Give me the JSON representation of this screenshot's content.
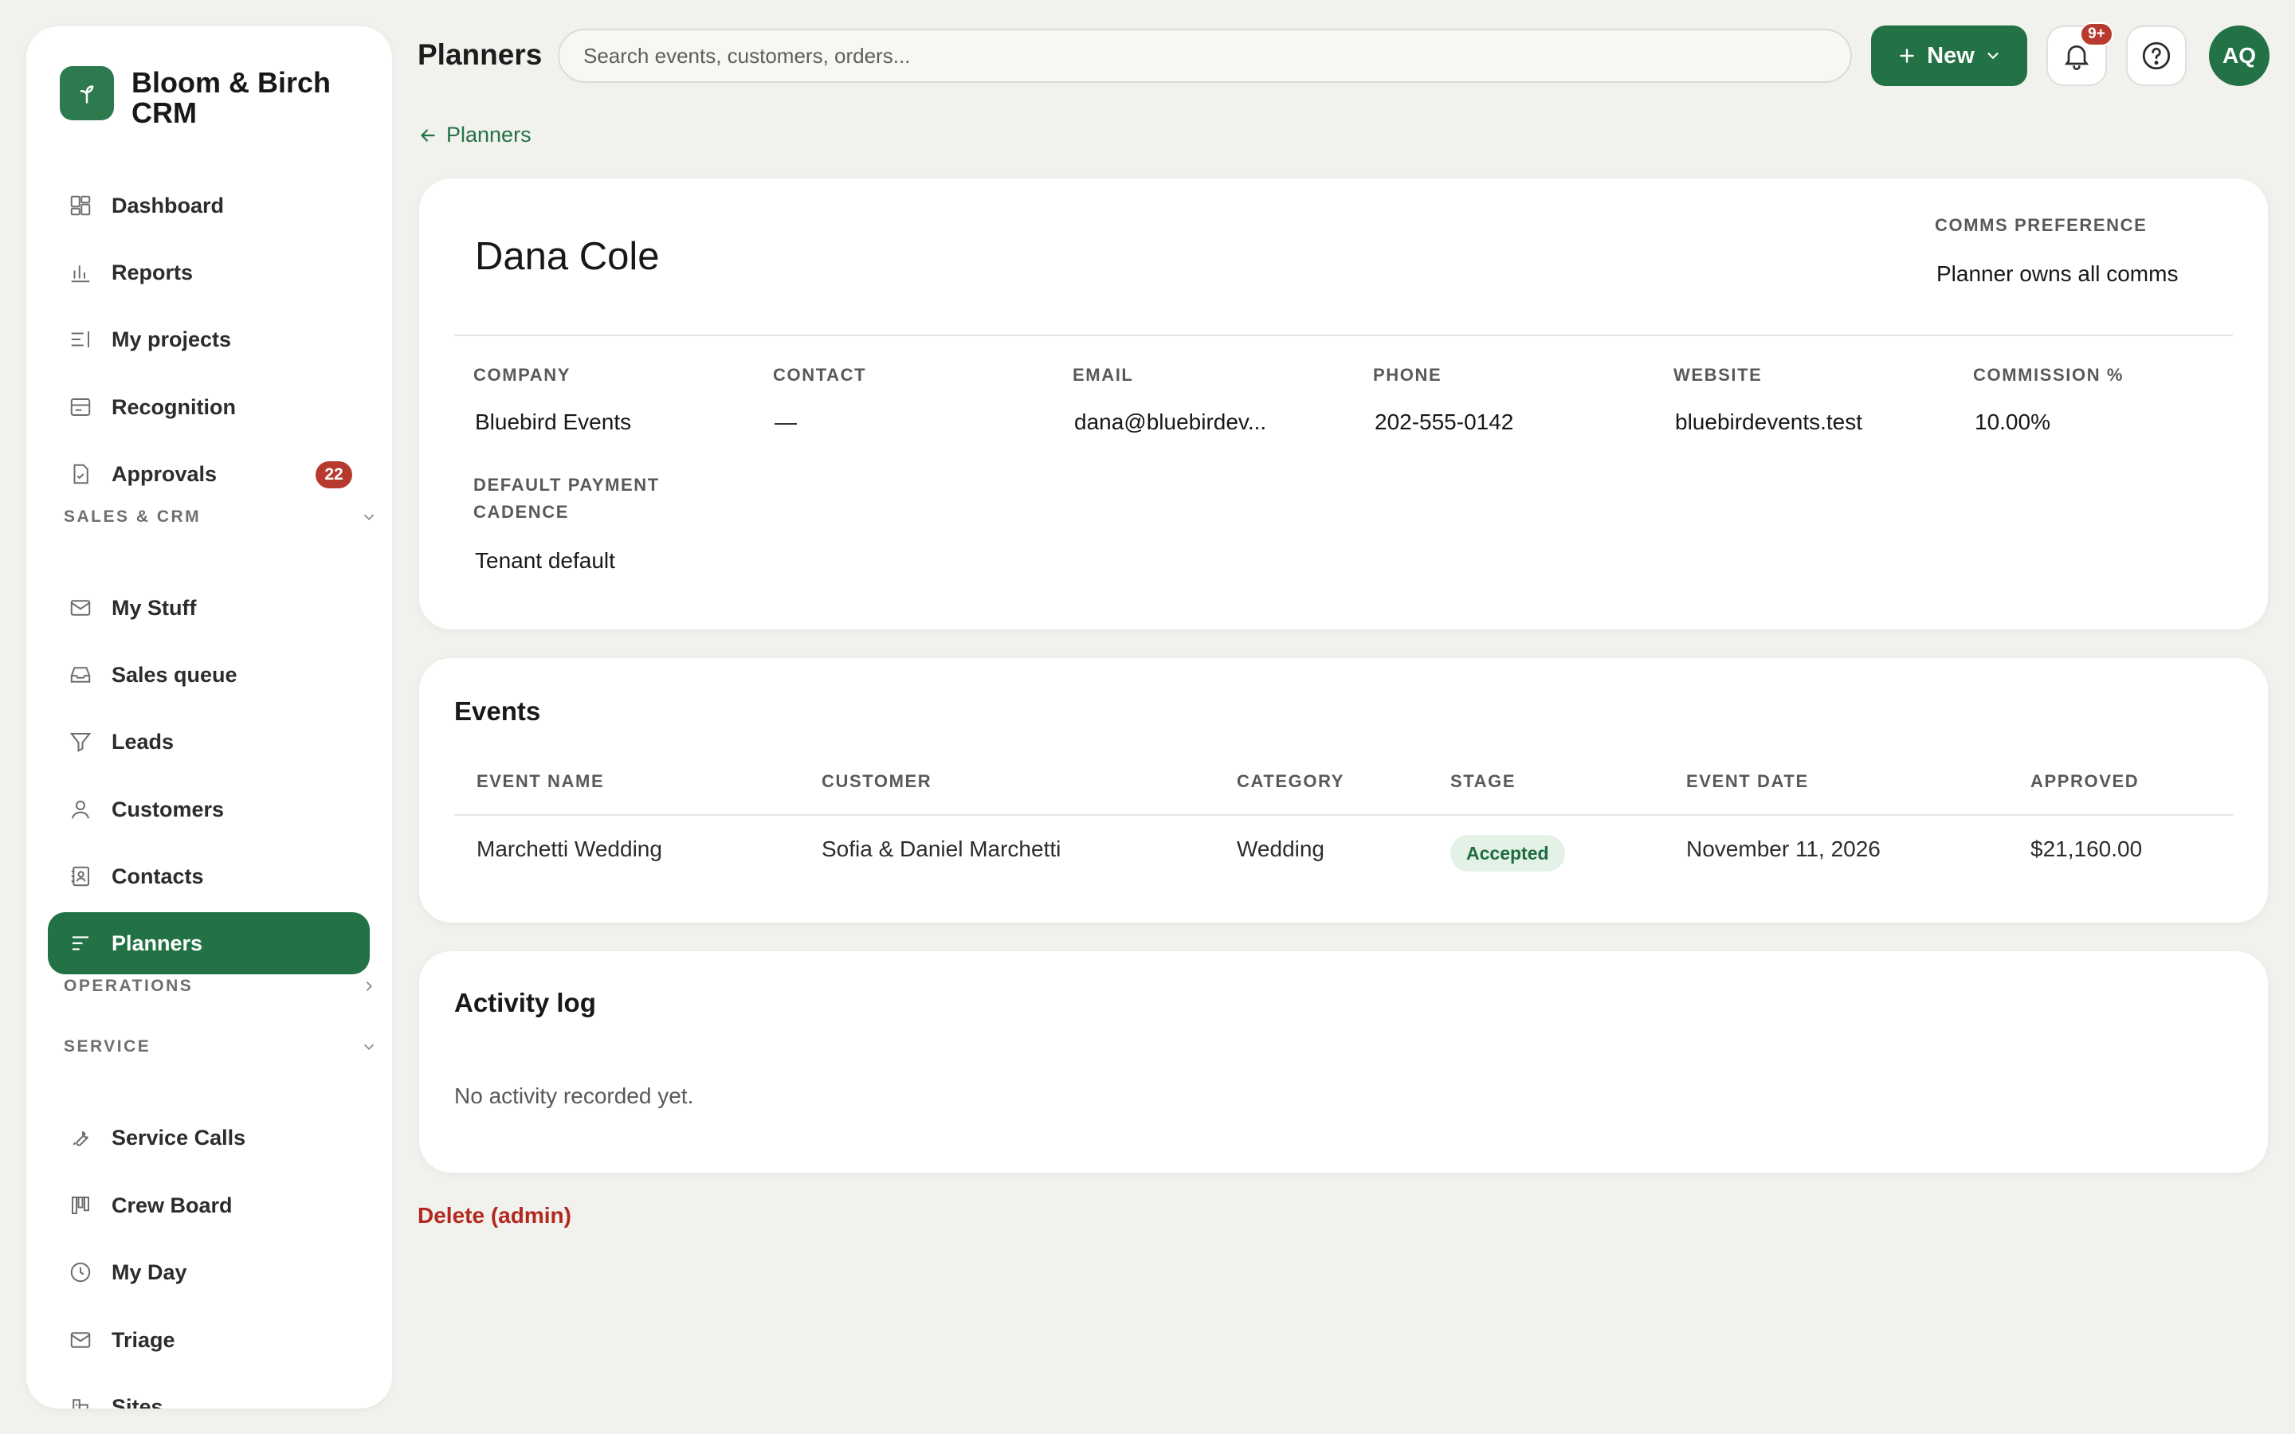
{
  "app": {
    "name": "Bloom & Birch CRM"
  },
  "sidebar": {
    "top_items": [
      {
        "label": "Dashboard",
        "icon": "dashboard-icon"
      },
      {
        "label": "Reports",
        "icon": "bar-chart-icon"
      },
      {
        "label": "My projects",
        "icon": "list-icon"
      },
      {
        "label": "Recognition",
        "icon": "card-icon"
      },
      {
        "label": "Approvals",
        "icon": "document-check-icon",
        "badge": "22"
      }
    ],
    "sections": [
      {
        "label": "SALES & CRM",
        "state": "expanded"
      },
      {
        "label": "OPERATIONS",
        "state": "collapsed"
      },
      {
        "label": "SERVICE",
        "state": "expanded"
      }
    ],
    "sales_items": [
      {
        "label": "My Stuff",
        "icon": "mail-icon"
      },
      {
        "label": "Sales queue",
        "icon": "inbox-icon"
      },
      {
        "label": "Leads",
        "icon": "filter-icon"
      },
      {
        "label": "Customers",
        "icon": "user-icon"
      },
      {
        "label": "Contacts",
        "icon": "contact-book-icon"
      },
      {
        "label": "Planners",
        "icon": "planner-icon",
        "active": true
      }
    ],
    "service_items": [
      {
        "label": "Service Calls",
        "icon": "wrench-icon"
      },
      {
        "label": "Crew Board",
        "icon": "kanban-icon"
      },
      {
        "label": "My Day",
        "icon": "clock-icon"
      },
      {
        "label": "Triage",
        "icon": "mail-icon"
      },
      {
        "label": "Sites",
        "icon": "building-icon"
      }
    ]
  },
  "header": {
    "title": "Planners",
    "search_placeholder": "Search events, customers, orders...",
    "new_label": "New",
    "notifications_badge": "9+",
    "avatar_initials": "AQ"
  },
  "breadcrumb": {
    "back_label": "Planners"
  },
  "planner": {
    "name": "Dana Cole",
    "comms_preference_label": "COMMS PREFERENCE",
    "comms_preference_value": "Planner owns all comms",
    "fields": [
      {
        "label": "COMPANY",
        "value": "Bluebird Events"
      },
      {
        "label": "CONTACT",
        "value": "—"
      },
      {
        "label": "EMAIL",
        "value": "dana@bluebirdev..."
      },
      {
        "label": "PHONE",
        "value": "202-555-0142"
      },
      {
        "label": "WEBSITE",
        "value": "bluebirdevents.test"
      },
      {
        "label": "COMMISSION %",
        "value": "10.00%"
      }
    ],
    "payment_cadence_label_line1": "DEFAULT PAYMENT",
    "payment_cadence_label_line2": "CADENCE",
    "payment_cadence_value": "Tenant default"
  },
  "events": {
    "title": "Events",
    "columns": [
      "EVENT NAME",
      "CUSTOMER",
      "CATEGORY",
      "STAGE",
      "EVENT DATE",
      "APPROVED"
    ],
    "rows": [
      {
        "event_name": "Marchetti Wedding",
        "customer": "Sofia & Daniel Marchetti",
        "category": "Wedding",
        "stage": "Accepted",
        "event_date": "November 11, 2026",
        "approved": "$21,160.00"
      }
    ]
  },
  "activity_log": {
    "title": "Activity log",
    "empty_text": "No activity recorded yet."
  },
  "delete_label": "Delete (admin)",
  "colors": {
    "brand_green": "#237245",
    "badge_red": "#b83a2e",
    "delete_red": "#b3281e",
    "background": "#f1f1ed"
  }
}
